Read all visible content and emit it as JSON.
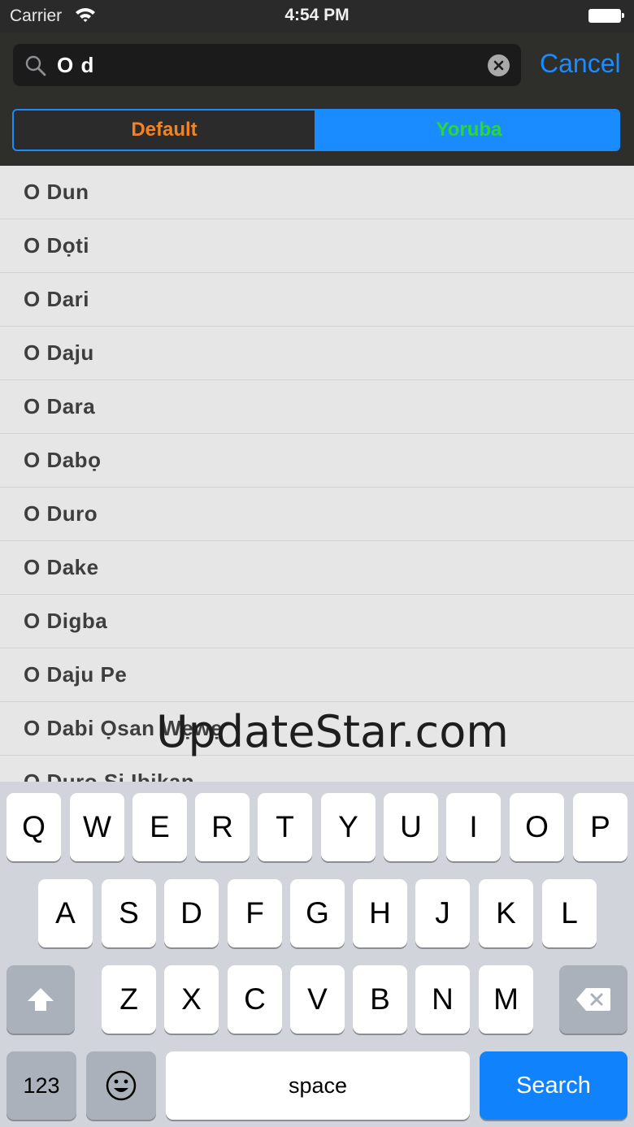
{
  "status_bar": {
    "carrier": "Carrier",
    "time": "4:54 PM"
  },
  "search": {
    "value": "O d",
    "cancel_label": "Cancel"
  },
  "segments": [
    {
      "label": "Default",
      "color": "#f58220",
      "selected": false
    },
    {
      "label": "Yoruba",
      "color": "#2bd92b",
      "selected": true
    }
  ],
  "results": [
    "O Dun",
    "O Dọti",
    "O Dari",
    "O Daju",
    "O Dara",
    "O Dabọ",
    "O Duro",
    "O Dake",
    "O Digba",
    "O Daju Pe",
    "O Dabi Ọsan Wẹwẹ",
    "O Duro Si Ibikan"
  ],
  "watermark": "UpdateStar.com",
  "keyboard": {
    "row1": [
      "Q",
      "W",
      "E",
      "R",
      "T",
      "Y",
      "U",
      "I",
      "O",
      "P"
    ],
    "row2": [
      "A",
      "S",
      "D",
      "F",
      "G",
      "H",
      "J",
      "K",
      "L"
    ],
    "row3": [
      "Z",
      "X",
      "C",
      "V",
      "B",
      "N",
      "M"
    ],
    "numbers_label": "123",
    "space_label": "space",
    "search_label": "Search"
  },
  "colors": {
    "accent": "#1a8cff",
    "search_key": "#1082fb"
  }
}
